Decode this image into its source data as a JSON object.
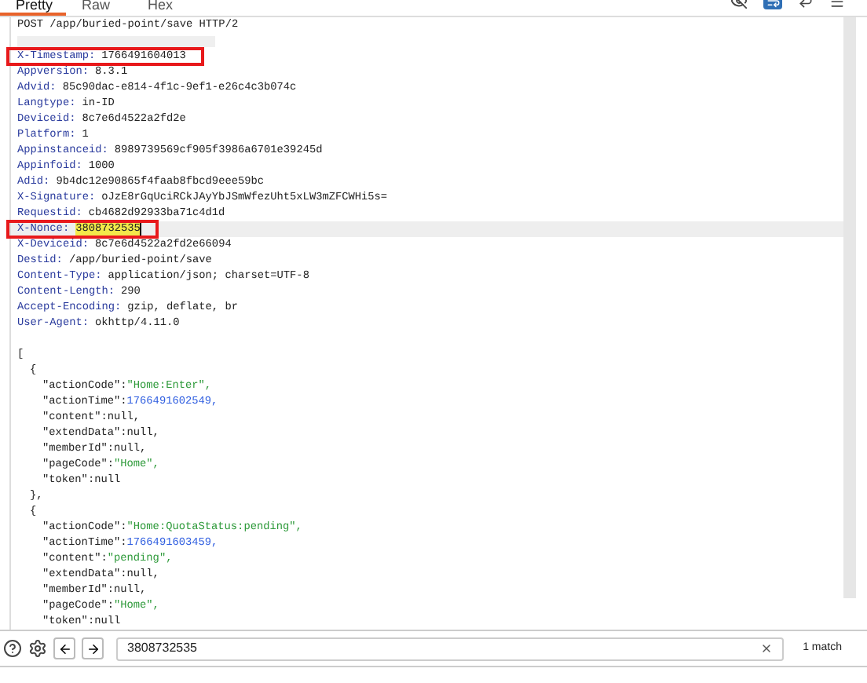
{
  "tabs": [
    {
      "label": "Pretty",
      "selected": true
    },
    {
      "label": "Raw",
      "selected": false
    },
    {
      "label": "Hex",
      "selected": false
    }
  ],
  "request_line": "POST /app/buried-point/save HTTP/2",
  "headers": [
    {
      "name": "X-Timestamp:",
      "value": "1766491604013",
      "annotated": true,
      "current": false,
      "match": false
    },
    {
      "name": "Appversion:",
      "value": "8.3.1",
      "annotated": false,
      "current": false,
      "match": false
    },
    {
      "name": "Advid:",
      "value": "85c90dac-e814-4f1c-9ef1-e26c4c3b074c",
      "annotated": false,
      "current": false,
      "match": false
    },
    {
      "name": "Langtype:",
      "value": "in-ID",
      "annotated": false,
      "current": false,
      "match": false
    },
    {
      "name": "Deviceid:",
      "value": "8c7e6d4522a2fd2e",
      "annotated": false,
      "current": false,
      "match": false
    },
    {
      "name": "Platform:",
      "value": "1",
      "annotated": false,
      "current": false,
      "match": false
    },
    {
      "name": "Appinstanceid:",
      "value": "8989739569cf905f3986a6701e39245d",
      "annotated": false,
      "current": false,
      "match": false
    },
    {
      "name": "Appinfoid:",
      "value": "1000",
      "annotated": false,
      "current": false,
      "match": false
    },
    {
      "name": "Adid:",
      "value": "9b4dc12e90865f4faab8fbcd9eee59bc",
      "annotated": false,
      "current": false,
      "match": false
    },
    {
      "name": "X-Signature:",
      "value": "oJzE8rGqUciRCkJAyYbJSmWfezUht5xLW3mZFCWHi5s=",
      "annotated": false,
      "current": false,
      "match": false
    },
    {
      "name": "Requestid:",
      "value": "cb4682d92933ba71c4d1d",
      "annotated": false,
      "current": false,
      "match": false
    },
    {
      "name": "X-Nonce:",
      "value": "3808732535",
      "annotated": true,
      "current": true,
      "match": true
    },
    {
      "name": "X-Deviceid:",
      "value": "8c7e6d4522a2fd2e66094",
      "annotated": false,
      "current": false,
      "match": false
    },
    {
      "name": "Destid:",
      "value": "/app/buried-point/save",
      "annotated": false,
      "current": false,
      "match": false
    },
    {
      "name": "Content-Type:",
      "value": "application/json; charset=UTF-8",
      "annotated": false,
      "current": false,
      "match": false
    },
    {
      "name": "Content-Length:",
      "value": "290",
      "annotated": false,
      "current": false,
      "match": false
    },
    {
      "name": "Accept-Encoding:",
      "value": "gzip, deflate, br",
      "annotated": false,
      "current": false,
      "match": false
    },
    {
      "name": "User-Agent:",
      "value": "okhttp/4.11.0",
      "annotated": false,
      "current": false,
      "match": false
    }
  ],
  "body": {
    "open": "[",
    "objects": [
      {
        "open": "{",
        "close": "},",
        "fields": [
          {
            "key": "\"actionCode\":",
            "value": "\"Home:Enter\",",
            "kind": "string"
          },
          {
            "key": "\"actionTime\":",
            "value": "1766491602549,",
            "kind": "number"
          },
          {
            "key": "\"content\":",
            "value": "null,",
            "kind": "null"
          },
          {
            "key": "\"extendData\":",
            "value": "null,",
            "kind": "null"
          },
          {
            "key": "\"memberId\":",
            "value": "null,",
            "kind": "null"
          },
          {
            "key": "\"pageCode\":",
            "value": "\"Home\",",
            "kind": "string"
          },
          {
            "key": "\"token\":",
            "value": "null",
            "kind": "null"
          }
        ]
      },
      {
        "open": "{",
        "fields": [
          {
            "key": "\"actionCode\":",
            "value": "\"Home:QuotaStatus:pending\",",
            "kind": "string"
          },
          {
            "key": "\"actionTime\":",
            "value": "1766491603459,",
            "kind": "number"
          },
          {
            "key": "\"content\":",
            "value": "\"pending\",",
            "kind": "string"
          },
          {
            "key": "\"extendData\":",
            "value": "null,",
            "kind": "null"
          },
          {
            "key": "\"memberId\":",
            "value": "null,",
            "kind": "null"
          },
          {
            "key": "\"pageCode\":",
            "value": "\"Home\",",
            "kind": "string"
          },
          {
            "key": "\"token\":",
            "value": "null",
            "kind": "null"
          }
        ]
      }
    ]
  },
  "search": {
    "value": "3808732535",
    "result": "1 match"
  }
}
